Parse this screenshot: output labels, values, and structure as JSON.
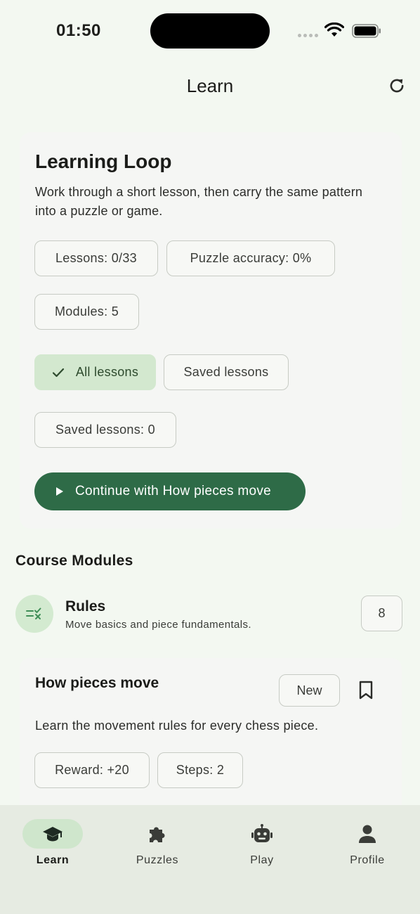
{
  "status_bar": {
    "time": "01:50"
  },
  "header": {
    "title": "Learn",
    "refresh_icon": "refresh-icon"
  },
  "hero": {
    "title": "Learning Loop",
    "description": "Work through a short lesson, then carry the same pattern into a puzzle or game.",
    "stats": {
      "lessons": "Lessons: 0/33",
      "puzzle_accuracy": "Puzzle accuracy: 0%",
      "modules": "Modules: 5"
    },
    "filters": {
      "all_lessons": "All lessons",
      "saved_lessons": "Saved lessons",
      "selected": "All lessons"
    },
    "saved_count": "Saved lessons: 0",
    "continue_label": "Continue with How pieces move"
  },
  "course_modules": {
    "heading": "Course Modules",
    "modules": [
      {
        "name": "Rules",
        "description": "Move basics and piece fundamentals.",
        "count": "8",
        "icon": "rules-icon"
      }
    ]
  },
  "lesson": {
    "title": "How pieces move",
    "badge": "New",
    "description": "Learn the movement rules for every chess piece.",
    "reward": "Reward: +20",
    "steps": "Steps: 2"
  },
  "bottom_nav": {
    "items": [
      {
        "label": "Learn",
        "icon": "graduation-cap-icon",
        "active": true
      },
      {
        "label": "Puzzles",
        "icon": "puzzle-piece-icon",
        "active": false
      },
      {
        "label": "Play",
        "icon": "robot-icon",
        "active": false
      },
      {
        "label": "Profile",
        "icon": "person-icon",
        "active": false
      }
    ]
  },
  "colors": {
    "background": "#f3f8f1",
    "card": "#f5f6f4",
    "accent": "#2e6b47",
    "selected_chip": "#d3e8cf",
    "nav_bar": "#e6ebe2"
  }
}
